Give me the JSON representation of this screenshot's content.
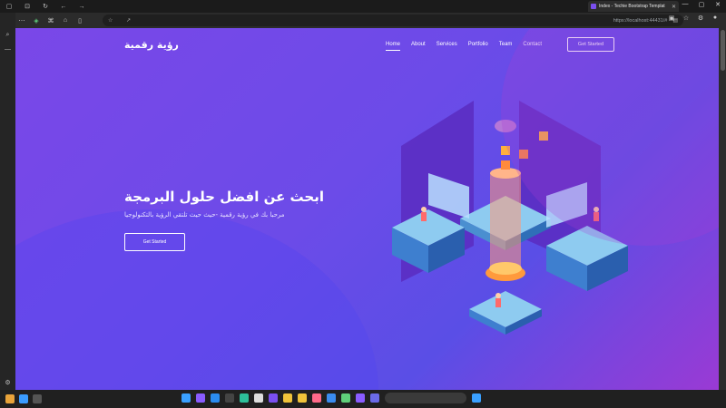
{
  "browser": {
    "tab_title": "Index - Techie Bootstrap Templat",
    "url": "https://localhost:44431/#",
    "icons": [
      "back-icon",
      "refresh-icon",
      "home-icon",
      "star-icon"
    ]
  },
  "site": {
    "brand": "رؤية رقمية",
    "nav": [
      "Home",
      "About",
      "Services",
      "Portfolio",
      "Team",
      "Contact"
    ],
    "cta": "Get Started",
    "hero_title": "ابحث عن افضل حلول البرمجة",
    "hero_subtitle": "مرحبا بك في رؤية رقمية -حيث حيث تلتقي الرؤية بالتكنولوجيا",
    "hero_button": "Get Started"
  },
  "colors": {
    "accent": "#7a47e8",
    "brand": "#ffffff",
    "orange": "#ff9a3c"
  }
}
